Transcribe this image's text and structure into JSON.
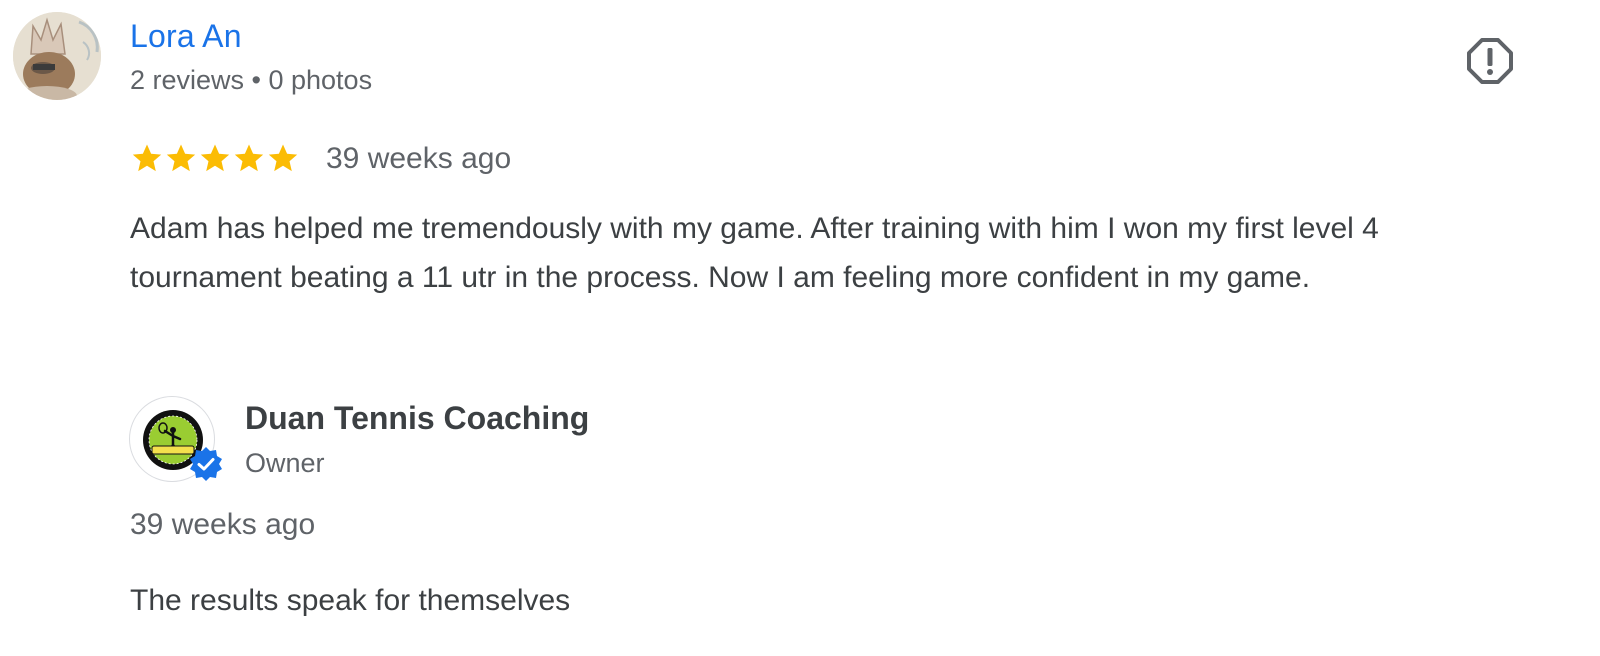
{
  "reviewer": {
    "name": "Lora An",
    "meta": "2 reviews • 0 photos",
    "avatar_icon": "cartoon-animal-with-crown-avatar"
  },
  "review": {
    "rating": 5,
    "rating_max": 5,
    "time": "39 weeks ago",
    "text": "Adam has helped me tremendously with my game. After training with him I won my first level 4 tournament beating a 11 utr in the process. Now I am feeling more confident in my game."
  },
  "owner_response": {
    "name": "Duan Tennis Coaching",
    "role": "Owner",
    "time": "39 weeks ago",
    "text": "The results speak for themselves",
    "logo_icon": "tennis-academy-logo"
  },
  "icons": {
    "flag": "flag-report-icon",
    "star": "star-icon",
    "verified": "verified-badge-icon"
  },
  "colors": {
    "name_link": "#1a73e8",
    "star": "#fbbc04",
    "verified": "#1a73e8",
    "secondary_text": "#5f6368",
    "primary_text": "#3c4043"
  }
}
